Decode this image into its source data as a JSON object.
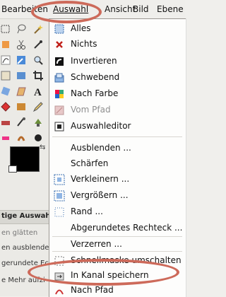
{
  "menubar": {
    "items": [
      "Bearbeiten",
      "Auswahl",
      "Ansicht",
      "Bild",
      "Ebene"
    ]
  },
  "toolbox": {
    "options_tab": "tige Auswahl",
    "option_lines": [
      "en glätten",
      "en ausblenden",
      "gerundete Ecken",
      "e Mehr aufzi"
    ]
  },
  "menu": {
    "items": [
      {
        "label": "Alles",
        "icon": "select-all-icon",
        "disabled": false
      },
      {
        "label": "Nichts",
        "icon": "select-none-icon",
        "disabled": false
      },
      {
        "label": "Invertieren",
        "icon": "invert-icon",
        "disabled": false
      },
      {
        "label": "Schwebend",
        "icon": "float-icon",
        "disabled": false
      },
      {
        "label": "Nach Farbe",
        "icon": "by-color-icon",
        "disabled": false
      },
      {
        "label": "Vom Pfad",
        "icon": "from-path-icon",
        "disabled": true
      },
      {
        "label": "Auswahleditor",
        "icon": "selection-editor-icon",
        "disabled": false
      },
      {
        "label": "Ausblenden ...",
        "icon": "",
        "disabled": false
      },
      {
        "label": "Schärfen",
        "icon": "",
        "disabled": false
      },
      {
        "label": "Verkleinern ...",
        "icon": "shrink-icon",
        "disabled": false
      },
      {
        "label": "Vergrößern ...",
        "icon": "grow-icon",
        "disabled": false
      },
      {
        "label": "Rand ...",
        "icon": "border-icon",
        "disabled": false
      },
      {
        "label": "Abgerundetes Rechteck ...",
        "icon": "",
        "disabled": false
      },
      {
        "label": "Verzerren ...",
        "icon": "",
        "disabled": false
      },
      {
        "label": "Schnellmaske umschalten",
        "icon": "quickmask-icon",
        "disabled": false
      },
      {
        "label": "In Kanal speichern",
        "icon": "channel-save-icon",
        "disabled": false
      },
      {
        "label": "Nach Pfad",
        "icon": "to-path-icon",
        "disabled": false
      }
    ]
  },
  "colors": {
    "annotation": "#cd6a5a",
    "menu_bg": "#fdfdfc",
    "disabled": "#8f8f8f"
  }
}
